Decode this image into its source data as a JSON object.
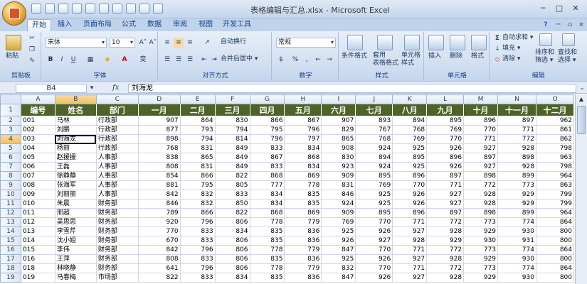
{
  "window": {
    "title": "表格编辑与汇总.xlsx - Microsoft Excel",
    "minimize": "─",
    "restore": "□",
    "close": "✕"
  },
  "tabs": [
    "开始",
    "插入",
    "页面布局",
    "公式",
    "数据",
    "审阅",
    "视图",
    "开发工具"
  ],
  "ribbon": {
    "clipboard": {
      "label": "剪贴板",
      "paste": "粘贴"
    },
    "font": {
      "label": "字体",
      "name": "宋体",
      "size": "10",
      "bold": "B",
      "italic": "I",
      "underline": "U",
      "grow": "A˄",
      "shrink": "A˅",
      "fontcolor": "A",
      "wen": "变"
    },
    "alignment": {
      "label": "对齐方式",
      "wrap": "自动换行",
      "merge": "合并后居中 ▾"
    },
    "number": {
      "label": "数字",
      "format": "常规",
      "percent": "%",
      "comma": ","
    },
    "styles": {
      "label": "样式",
      "conditional": "条件格式",
      "table": "套用\n表格格式",
      "cell": "单元格\n样式"
    },
    "cells": {
      "label": "单元格",
      "insert": "插入",
      "delete": "删除",
      "format": "格式"
    },
    "editing": {
      "label": "编辑",
      "autosum": "自动求和 ▾",
      "fill": "填充 ▾",
      "clear": "清除 ▾",
      "sort": "排序和\n筛选 ▾",
      "find": "查找和\n选择 ▾"
    }
  },
  "formula_bar": {
    "name_box": "B4",
    "fx": "fx",
    "content": "刘海龙"
  },
  "columns": [
    "A",
    "B",
    "C",
    "D",
    "E",
    "F",
    "G",
    "H",
    "I",
    "J",
    "K",
    "L",
    "M",
    "N",
    "O"
  ],
  "header_row": [
    "编号",
    "姓名",
    "部门",
    "一月",
    "二月",
    "三月",
    "四月",
    "五月",
    "六月",
    "七月",
    "八月",
    "九月",
    "十月",
    "十一月",
    "十二月"
  ],
  "rows": [
    [
      "001",
      "马林",
      "行政部",
      "907",
      "864",
      "830",
      "866",
      "867",
      "907",
      "893",
      "894",
      "895",
      "896",
      "897",
      "962"
    ],
    [
      "002",
      "刘鹏",
      "行政部",
      "877",
      "793",
      "794",
      "795",
      "796",
      "829",
      "767",
      "768",
      "769",
      "770",
      "771",
      "861"
    ],
    [
      "003",
      "刘海龙",
      "行政部",
      "898",
      "794",
      "814",
      "796",
      "797",
      "865",
      "768",
      "769",
      "770",
      "771",
      "772",
      "862"
    ],
    [
      "004",
      "杨丽",
      "行政部",
      "768",
      "831",
      "849",
      "833",
      "834",
      "908",
      "924",
      "925",
      "926",
      "927",
      "928",
      "798"
    ],
    [
      "005",
      "赵援援",
      "人事部",
      "838",
      "865",
      "849",
      "867",
      "868",
      "830",
      "894",
      "895",
      "896",
      "897",
      "898",
      "963"
    ],
    [
      "006",
      "王磊",
      "人事部",
      "808",
      "831",
      "849",
      "833",
      "834",
      "923",
      "924",
      "925",
      "926",
      "927",
      "928",
      "798"
    ],
    [
      "007",
      "徐静静",
      "人事部",
      "854",
      "866",
      "822",
      "868",
      "869",
      "909",
      "895",
      "896",
      "897",
      "898",
      "899",
      "964"
    ],
    [
      "008",
      "张海军",
      "人事部",
      "881",
      "795",
      "805",
      "777",
      "778",
      "831",
      "769",
      "770",
      "771",
      "772",
      "773",
      "863"
    ],
    [
      "009",
      "刘丽丽",
      "人事部",
      "842",
      "832",
      "833",
      "834",
      "835",
      "846",
      "925",
      "926",
      "927",
      "928",
      "929",
      "799"
    ],
    [
      "010",
      "朱晨",
      "财务部",
      "846",
      "832",
      "850",
      "834",
      "835",
      "924",
      "925",
      "926",
      "927",
      "928",
      "929",
      "799"
    ],
    [
      "011",
      "邢超",
      "财务部",
      "789",
      "866",
      "822",
      "868",
      "869",
      "909",
      "895",
      "896",
      "897",
      "898",
      "899",
      "964"
    ],
    [
      "012",
      "吴思思",
      "财务部",
      "920",
      "796",
      "806",
      "778",
      "779",
      "769",
      "770",
      "771",
      "772",
      "773",
      "774",
      "864"
    ],
    [
      "013",
      "李雪芹",
      "财务部",
      "770",
      "833",
      "834",
      "835",
      "836",
      "925",
      "926",
      "927",
      "928",
      "929",
      "930",
      "800"
    ],
    [
      "014",
      "沈小姐",
      "财务部",
      "670",
      "833",
      "806",
      "835",
      "836",
      "926",
      "927",
      "928",
      "929",
      "930",
      "931",
      "800"
    ],
    [
      "015",
      "李伟",
      "财务部",
      "842",
      "796",
      "806",
      "778",
      "779",
      "847",
      "770",
      "771",
      "772",
      "773",
      "774",
      "864"
    ],
    [
      "016",
      "王萍",
      "财务部",
      "808",
      "833",
      "806",
      "835",
      "836",
      "925",
      "926",
      "927",
      "928",
      "929",
      "930",
      "800"
    ],
    [
      "018",
      "林晓静",
      "财务部",
      "641",
      "796",
      "806",
      "778",
      "779",
      "832",
      "770",
      "771",
      "772",
      "773",
      "774",
      "864"
    ],
    [
      "019",
      "马春梅",
      "市场部",
      "822",
      "833",
      "834",
      "835",
      "836",
      "847",
      "926",
      "927",
      "928",
      "929",
      "930",
      "800"
    ]
  ]
}
